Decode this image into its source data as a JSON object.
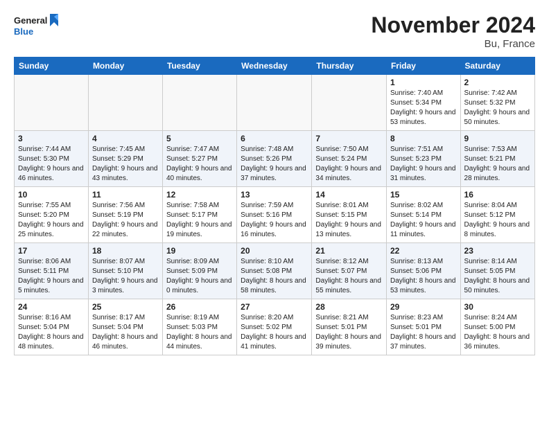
{
  "header": {
    "logo_general": "General",
    "logo_blue": "Blue",
    "month": "November 2024",
    "location": "Bu, France"
  },
  "weekdays": [
    "Sunday",
    "Monday",
    "Tuesday",
    "Wednesday",
    "Thursday",
    "Friday",
    "Saturday"
  ],
  "weeks": [
    [
      {
        "day": "",
        "info": ""
      },
      {
        "day": "",
        "info": ""
      },
      {
        "day": "",
        "info": ""
      },
      {
        "day": "",
        "info": ""
      },
      {
        "day": "",
        "info": ""
      },
      {
        "day": "1",
        "info": "Sunrise: 7:40 AM\nSunset: 5:34 PM\nDaylight: 9 hours and 53 minutes."
      },
      {
        "day": "2",
        "info": "Sunrise: 7:42 AM\nSunset: 5:32 PM\nDaylight: 9 hours and 50 minutes."
      }
    ],
    [
      {
        "day": "3",
        "info": "Sunrise: 7:44 AM\nSunset: 5:30 PM\nDaylight: 9 hours and 46 minutes."
      },
      {
        "day": "4",
        "info": "Sunrise: 7:45 AM\nSunset: 5:29 PM\nDaylight: 9 hours and 43 minutes."
      },
      {
        "day": "5",
        "info": "Sunrise: 7:47 AM\nSunset: 5:27 PM\nDaylight: 9 hours and 40 minutes."
      },
      {
        "day": "6",
        "info": "Sunrise: 7:48 AM\nSunset: 5:26 PM\nDaylight: 9 hours and 37 minutes."
      },
      {
        "day": "7",
        "info": "Sunrise: 7:50 AM\nSunset: 5:24 PM\nDaylight: 9 hours and 34 minutes."
      },
      {
        "day": "8",
        "info": "Sunrise: 7:51 AM\nSunset: 5:23 PM\nDaylight: 9 hours and 31 minutes."
      },
      {
        "day": "9",
        "info": "Sunrise: 7:53 AM\nSunset: 5:21 PM\nDaylight: 9 hours and 28 minutes."
      }
    ],
    [
      {
        "day": "10",
        "info": "Sunrise: 7:55 AM\nSunset: 5:20 PM\nDaylight: 9 hours and 25 minutes."
      },
      {
        "day": "11",
        "info": "Sunrise: 7:56 AM\nSunset: 5:19 PM\nDaylight: 9 hours and 22 minutes."
      },
      {
        "day": "12",
        "info": "Sunrise: 7:58 AM\nSunset: 5:17 PM\nDaylight: 9 hours and 19 minutes."
      },
      {
        "day": "13",
        "info": "Sunrise: 7:59 AM\nSunset: 5:16 PM\nDaylight: 9 hours and 16 minutes."
      },
      {
        "day": "14",
        "info": "Sunrise: 8:01 AM\nSunset: 5:15 PM\nDaylight: 9 hours and 13 minutes."
      },
      {
        "day": "15",
        "info": "Sunrise: 8:02 AM\nSunset: 5:14 PM\nDaylight: 9 hours and 11 minutes."
      },
      {
        "day": "16",
        "info": "Sunrise: 8:04 AM\nSunset: 5:12 PM\nDaylight: 9 hours and 8 minutes."
      }
    ],
    [
      {
        "day": "17",
        "info": "Sunrise: 8:06 AM\nSunset: 5:11 PM\nDaylight: 9 hours and 5 minutes."
      },
      {
        "day": "18",
        "info": "Sunrise: 8:07 AM\nSunset: 5:10 PM\nDaylight: 9 hours and 3 minutes."
      },
      {
        "day": "19",
        "info": "Sunrise: 8:09 AM\nSunset: 5:09 PM\nDaylight: 9 hours and 0 minutes."
      },
      {
        "day": "20",
        "info": "Sunrise: 8:10 AM\nSunset: 5:08 PM\nDaylight: 8 hours and 58 minutes."
      },
      {
        "day": "21",
        "info": "Sunrise: 8:12 AM\nSunset: 5:07 PM\nDaylight: 8 hours and 55 minutes."
      },
      {
        "day": "22",
        "info": "Sunrise: 8:13 AM\nSunset: 5:06 PM\nDaylight: 8 hours and 53 minutes."
      },
      {
        "day": "23",
        "info": "Sunrise: 8:14 AM\nSunset: 5:05 PM\nDaylight: 8 hours and 50 minutes."
      }
    ],
    [
      {
        "day": "24",
        "info": "Sunrise: 8:16 AM\nSunset: 5:04 PM\nDaylight: 8 hours and 48 minutes."
      },
      {
        "day": "25",
        "info": "Sunrise: 8:17 AM\nSunset: 5:04 PM\nDaylight: 8 hours and 46 minutes."
      },
      {
        "day": "26",
        "info": "Sunrise: 8:19 AM\nSunset: 5:03 PM\nDaylight: 8 hours and 44 minutes."
      },
      {
        "day": "27",
        "info": "Sunrise: 8:20 AM\nSunset: 5:02 PM\nDaylight: 8 hours and 41 minutes."
      },
      {
        "day": "28",
        "info": "Sunrise: 8:21 AM\nSunset: 5:01 PM\nDaylight: 8 hours and 39 minutes."
      },
      {
        "day": "29",
        "info": "Sunrise: 8:23 AM\nSunset: 5:01 PM\nDaylight: 8 hours and 37 minutes."
      },
      {
        "day": "30",
        "info": "Sunrise: 8:24 AM\nSunset: 5:00 PM\nDaylight: 8 hours and 36 minutes."
      }
    ]
  ]
}
